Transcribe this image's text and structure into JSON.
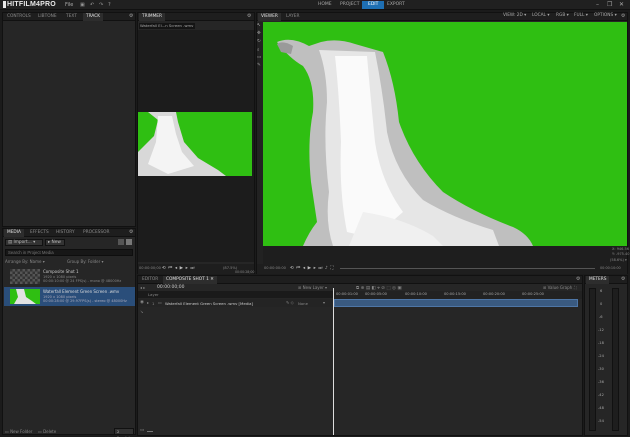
{
  "app": {
    "logo": "HITFILM4PRO",
    "file_menu": "File",
    "nav": [
      "HOME",
      "PROJECT",
      "EDIT",
      "EXPORT"
    ],
    "active_nav": "EDIT",
    "window_controls": [
      "–",
      "❐",
      "✕"
    ]
  },
  "left_top": {
    "tabs": [
      "CONTROLS",
      "LIBTONE",
      "TEXT",
      "TRACK"
    ],
    "active_tab": "TRACK"
  },
  "media": {
    "tabs": [
      "MEDIA",
      "EFFECTS",
      "HISTORY",
      "PROCESSOR"
    ],
    "active_tab": "MEDIA",
    "import_label": "Import...",
    "new_label": "New",
    "search_placeholder": "Search in Project Media",
    "arrange_label": "Arrange By: Name",
    "group_label": "Group By: Folder",
    "items": [
      {
        "name": "Composite Shot 1",
        "line2": "1920 x 1080 pixels",
        "line3": "00:00:10:00 @ 24 FPS(s) - mono @ 48000Hz"
      },
      {
        "name": "Waterfall Element Green Screen .wmv",
        "line2": "1920 x 1080 pixels",
        "line3": "00:00:28:00 @ 29.97FPS(s) - stereo @ 48000Hz"
      }
    ],
    "new_folder": "New Folder",
    "delete": "Delete",
    "item_count": "2 Item(s)"
  },
  "trimmer": {
    "tab": "TRIMMER",
    "file_label": "Waterfall El...n Screen .wmv",
    "time_left": "00:00:00;00",
    "zoom": "(87.5%)",
    "time_right": "00:00:28;00"
  },
  "viewer": {
    "tabs": [
      "VIEWER",
      "LAYER"
    ],
    "active_tab": "VIEWER",
    "view_label": "VIEW",
    "view_value": "2D",
    "local": "LOCAL",
    "rgb": "RGB",
    "full": "FULL",
    "options": "OPTIONS",
    "coord_x": "X: 946.56",
    "coord_y": "Y: -975.40",
    "zoom_value": "(58.6%)",
    "time_left": "00:00:00:00",
    "time_right": "00:00:10:00"
  },
  "timeline": {
    "tabs": [
      "EDITOR",
      "COMPOSITE SHOT 1"
    ],
    "active_tab": "COMPOSITE SHOT 1",
    "timecode": "00:00:00;00",
    "new_layer": "New Layer",
    "value_graph": "Value Graph",
    "layer_number": "1",
    "layer_name": "Waterfall Element Green Screen .wmv [Media]",
    "blend": "None",
    "ruler": [
      "00:00:01:00",
      "00:00:05:00",
      "00:00:10:00",
      "00:00:15:00",
      "00:00:20:00",
      "00:00:25:00"
    ],
    "layer_label": "Layer"
  },
  "meters": {
    "title": "METERS",
    "scale": [
      "6",
      "0",
      "-6",
      "-12",
      "-18",
      "-24",
      "-30",
      "-36",
      "-42",
      "-48",
      "-54"
    ]
  },
  "colors": {
    "accent": "#1e6fb3",
    "green_screen": "#2fbf12",
    "selected": "#2a4e7a"
  }
}
